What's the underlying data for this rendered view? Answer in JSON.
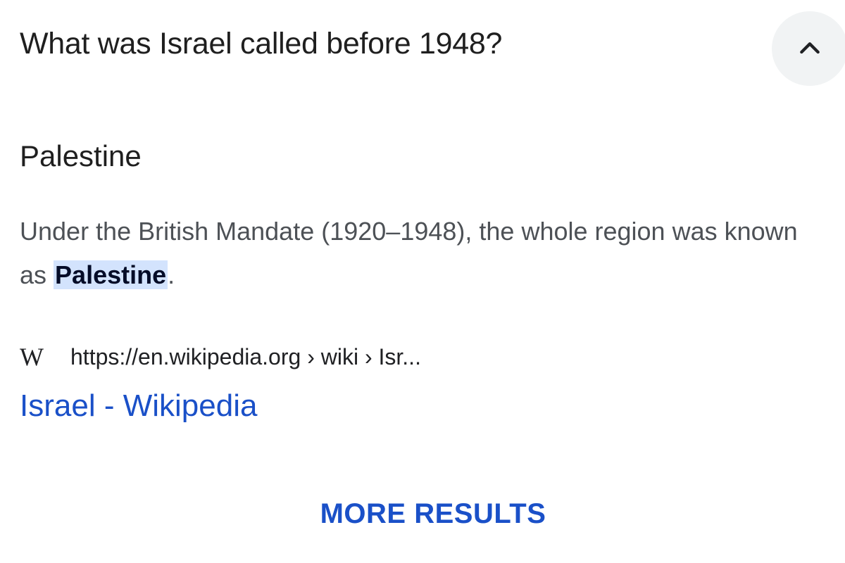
{
  "question": "What was Israel called before 1948?",
  "collapse_icon": "chevron-up-icon",
  "answer": {
    "title": "Palestine",
    "snippet_before": "Under the British Mandate (1920–1948), the whole region was known as ",
    "snippet_highlight": "Palestine",
    "snippet_after": "."
  },
  "source": {
    "logo_text": "W",
    "url": "https://en.wikipedia.org › wiki › Isr...",
    "result_title": "Israel - Wikipedia"
  },
  "more_results_label": "MORE RESULTS",
  "colors": {
    "link": "#1a50c8",
    "highlight_bg": "#d3e3fd",
    "button_bg": "#f1f3f4"
  }
}
